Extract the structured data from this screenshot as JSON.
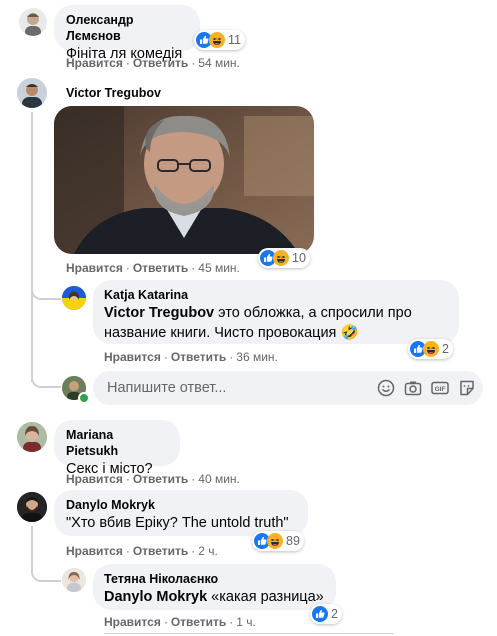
{
  "comments": [
    {
      "author": "Олександр Лємєнов",
      "text": "Фініта ля комедія",
      "reactions": {
        "icons": [
          "like-icon",
          "haha-icon"
        ],
        "count": "11"
      },
      "actions": {
        "like": "Нравится",
        "reply": "Ответить",
        "time": "54 мин."
      }
    },
    {
      "author": "Victor Tregubov",
      "text": "",
      "has_photo": true,
      "reactions": {
        "icons": [
          "like-icon",
          "haha-icon"
        ],
        "count": "10"
      },
      "actions": {
        "like": "Нравится",
        "reply": "Ответить",
        "time": "45 мин."
      },
      "replies": [
        {
          "author": "Katja Katarina",
          "mention": "Victor Tregubov",
          "text": " это обложка, а спросили про название книги. Чисто провокация 🤣",
          "text_line1": " это обложка, а спросили про",
          "text_line2": "название книги. Чисто провокация 🤣",
          "reactions": {
            "icons": [
              "like-icon",
              "haha-icon"
            ],
            "count": "2"
          },
          "actions": {
            "like": "Нравится",
            "reply": "Ответить",
            "time": "36 мин."
          }
        }
      ],
      "reply_box": {
        "placeholder": "Напишите ответ...",
        "tools": [
          "emoji-icon",
          "camera-icon",
          "gif-icon",
          "sticker-icon"
        ]
      }
    },
    {
      "author": "Mariana Pietsukh",
      "text": "Секс і місто?",
      "actions": {
        "like": "Нравится",
        "reply": "Ответить",
        "time": "40 мин."
      }
    },
    {
      "author": "Danylo Mokryk",
      "text": "\"Хто вбив Еріку? The untold truth\"",
      "reactions": {
        "icons": [
          "like-icon",
          "haha-icon"
        ],
        "count": "89"
      },
      "actions": {
        "like": "Нравится",
        "reply": "Ответить",
        "time": "2 ч."
      },
      "replies": [
        {
          "author": "Тетяна Ніколаєнко",
          "mention": "Danylo Mokryk",
          "text": " «какая разница»",
          "reactions": {
            "icons": [
              "like-icon"
            ],
            "count": "2"
          },
          "actions": {
            "like": "Нравится",
            "reply": "Ответить",
            "time": "1 ч."
          }
        }
      ]
    }
  ],
  "colors": {
    "bubble": "#f0f2f5",
    "meta": "#65676b",
    "like": "#1877f2",
    "haha": "#f7b125",
    "online": "#31a24c"
  }
}
